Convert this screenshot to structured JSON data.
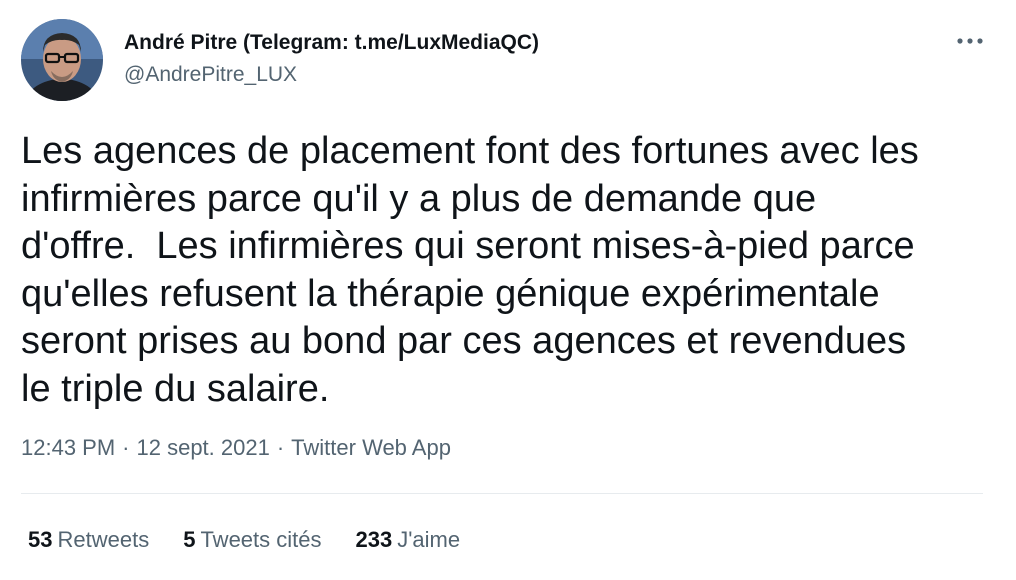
{
  "author": {
    "display_name": "André Pitre (Telegram: t.me/LuxMediaQC)",
    "handle": "@AndrePitre_LUX",
    "avatar_icon": "profile-photo"
  },
  "more_icon": "more-options-icon",
  "tweet": {
    "text": "Les agences de placement font des fortunes avec les\ninfirmières parce qu'il y a plus de demande que\nd'offre.  Les infirmières qui seront mises-à-pied parce\nqu'elles refusent la thérapie génique expérimentale\nseront prises au bond par ces agences et revendues\nle triple du salaire."
  },
  "meta": {
    "time": "12:43 PM",
    "separator": "·",
    "date": "12 sept. 2021",
    "source": "Twitter Web App"
  },
  "stats": {
    "retweets_count": "53",
    "retweets_label": "Retweets",
    "quotes_count": "5",
    "quotes_label": "Tweets cités",
    "likes_count": "233",
    "likes_label": "J'aime"
  },
  "colors": {
    "text_primary": "#0f1419",
    "text_secondary": "#536471",
    "divider": "#e7ebee"
  }
}
